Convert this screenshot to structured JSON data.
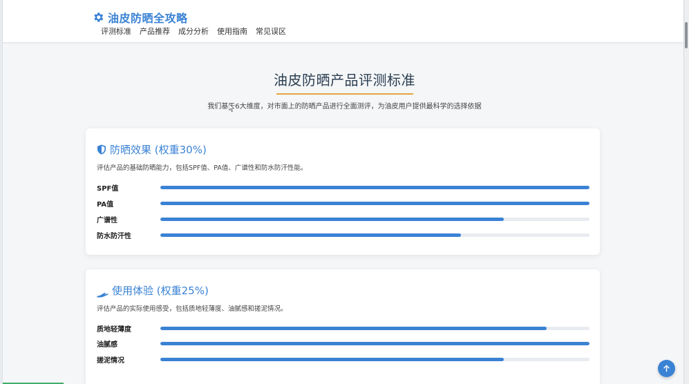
{
  "site": {
    "title": "油皮防晒全攻略",
    "logo_icon": "gear-icon"
  },
  "nav": {
    "items": [
      "评测标准",
      "产品推荐",
      "成分分析",
      "使用指南",
      "常见误区"
    ]
  },
  "hero": {
    "title": "油皮防晒产品评测标准",
    "subtitle": "我们基于6大维度，对市面上的防晒产品进行全面测评，为油皮用户提供最科学的选择依据"
  },
  "cards": [
    {
      "icon": "shield-icon",
      "title": "防晒效果 (权重30%)",
      "description": "评估产品的基础防晒能力，包括SPF值、PA值、广谱性和防水防汗性能。",
      "metrics": [
        {
          "label": "SPF值",
          "value": 100
        },
        {
          "label": "PA值",
          "value": 100
        },
        {
          "label": "广谱性",
          "value": 80
        },
        {
          "label": "防水防汗性",
          "value": 70
        }
      ]
    },
    {
      "icon": "hand-icon",
      "title": "使用体验 (权重25%)",
      "description": "评估产品的实际使用感受，包括质地轻薄度、油腻感和搓泥情况。",
      "metrics": [
        {
          "label": "质地轻薄度",
          "value": 90
        },
        {
          "label": "油腻感",
          "value": 100
        },
        {
          "label": "搓泥情况",
          "value": 80
        }
      ]
    }
  ],
  "colors": {
    "accent": "#3a82d4",
    "underline": "#e8a33b",
    "bar_track": "#e8ebef"
  },
  "back_to_top_icon": "arrow-up-icon"
}
